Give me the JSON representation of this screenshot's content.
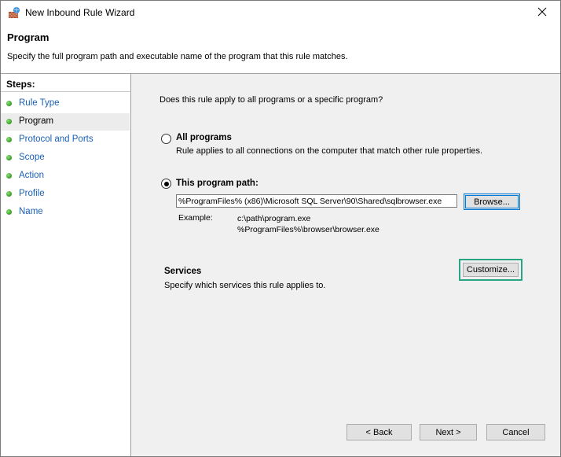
{
  "window": {
    "title": "New Inbound Rule Wizard",
    "close_glyph": "✕"
  },
  "header": {
    "title": "Program",
    "description": "Specify the full program path and executable name of the program that this rule matches."
  },
  "steps": {
    "title": "Steps:",
    "items": [
      {
        "label": "Rule Type",
        "selected": false
      },
      {
        "label": "Program",
        "selected": true
      },
      {
        "label": "Protocol and Ports",
        "selected": false
      },
      {
        "label": "Scope",
        "selected": false
      },
      {
        "label": "Action",
        "selected": false
      },
      {
        "label": "Profile",
        "selected": false
      },
      {
        "label": "Name",
        "selected": false
      }
    ]
  },
  "main": {
    "question": "Does this rule apply to all programs or a specific program?",
    "all_programs": {
      "label": "All programs",
      "description": "Rule applies to all connections on the computer that match other rule properties.",
      "checked": false
    },
    "program_path": {
      "label": "This program path:",
      "checked": true,
      "value": "%ProgramFiles% (x86)\\Microsoft SQL Server\\90\\Shared\\sqlbrowser.exe",
      "browse_label": "Browse...",
      "example_label": "Example:",
      "example_line1": "c:\\path\\program.exe",
      "example_line2": "%ProgramFiles%\\browser\\browser.exe"
    },
    "services": {
      "title": "Services",
      "description": "Specify which services this rule applies to.",
      "customize_label": "Customize..."
    }
  },
  "footer": {
    "back_label": "< Back",
    "next_label": "Next >",
    "cancel_label": "Cancel"
  },
  "colors": {
    "accent": "#0078d7",
    "highlight": "#2aa584",
    "link": "#1a5fb4"
  }
}
